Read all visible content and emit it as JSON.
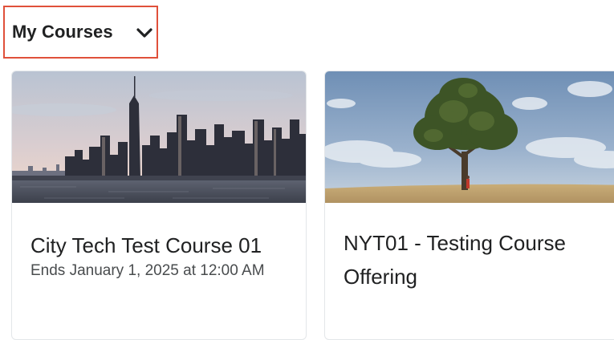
{
  "header": {
    "title": "My Courses",
    "dropdown_icon": "chevron-down-icon",
    "highlight_color": "#e0503a"
  },
  "courses": [
    {
      "title": "City Tech Test Course 01",
      "subtitle": "Ends January 1, 2025 at 12:00 AM",
      "image": "city-skyline-image"
    },
    {
      "title": "NYT01 - Testing Course Offering",
      "subtitle": "",
      "image": "tree-field-image"
    }
  ]
}
